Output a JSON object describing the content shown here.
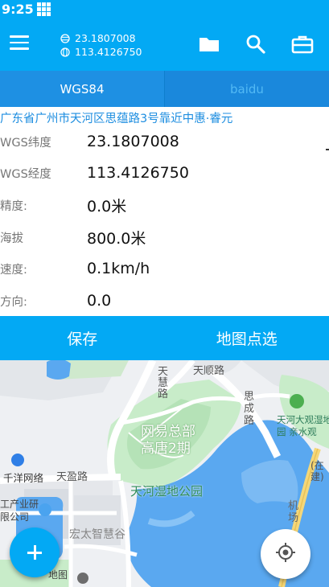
{
  "status_bar": {
    "time": "9:25",
    "notification_icon": "grid-icon"
  },
  "toolbar": {
    "menu_icon": "menu-icon",
    "latitude": "23.1807008",
    "longitude": "113.4126750",
    "lat_icon": "latitude-icon",
    "lon_icon": "globe-icon",
    "actions": [
      "folder-icon",
      "search-icon",
      "toolbox-icon"
    ]
  },
  "tabs": [
    {
      "label": "WGS84",
      "active": true
    },
    {
      "label": "baidu",
      "active": false
    }
  ],
  "info": {
    "address": "广东省广州市天河区思蕴路3号靠近中惠·睿元",
    "fields": [
      {
        "label": "WGS纬度",
        "value": "23.1807008"
      },
      {
        "label": "WGS经度",
        "value": "113.4126750"
      },
      {
        "label": "精度:",
        "value": "0.0米"
      },
      {
        "label": "海拔",
        "value": "800.0米"
      },
      {
        "label": "速度:",
        "value": "0.1km/h"
      },
      {
        "label": "方向:",
        "value": "0.0"
      }
    ]
  },
  "actions": {
    "save_label": "保存",
    "map_pick_label": "地图点选"
  },
  "map": {
    "labels": {
      "tianhui_road": "天慧路",
      "tianshun_road": "天顺路",
      "siding_road": "思成路",
      "netease_1": "网易总部",
      "netease_2": "高唐2期",
      "wetland_park": "天河湿地公园",
      "tianhe_wetland_1": "天河大观湿地",
      "tianhe_wetland_2": "园 亲水观",
      "tianying_road": "天盈路",
      "qianyang_net": "千洋网络",
      "industry_1": "工产业研",
      "industry_2": "限公司",
      "hongtai": "宏太智慧谷",
      "construction": "(在建)",
      "airport": "机场",
      "map_label": "地图"
    },
    "colors": {
      "water": "#5aa8f0",
      "park": "#c8ecc9",
      "road": "#ffffff",
      "highway": "#f4d77a"
    }
  },
  "fab": {
    "add_icon": "plus-icon",
    "locate_icon": "crosshair-icon"
  }
}
